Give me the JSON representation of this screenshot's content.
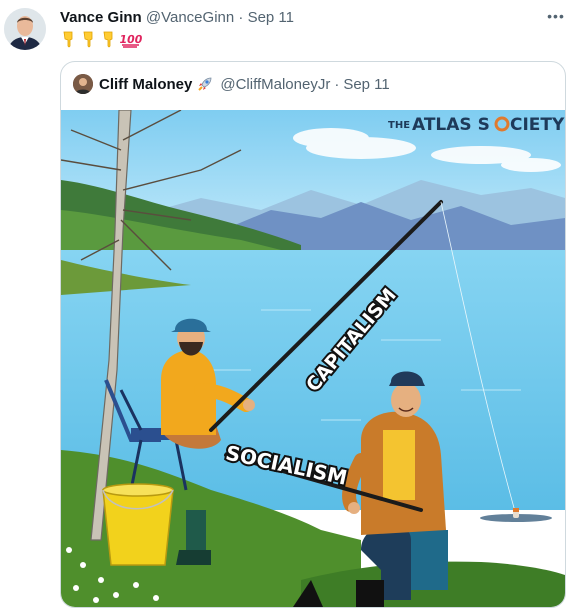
{
  "tweet": {
    "author_name": "Vance Ginn",
    "author_handle": "@VanceGinn",
    "separator": "·",
    "date": "Sep 11",
    "more_label": "•••",
    "emojis": [
      "pointing-down-hand-icon",
      "pointing-down-hand-icon",
      "pointing-down-hand-icon",
      "hundred-points-icon"
    ]
  },
  "quoted_tweet": {
    "author_name": "Cliff Maloney",
    "author_badge": "rocket-icon",
    "author_handle": "@CliffMaloneyJr",
    "separator": "·",
    "date": "Sep 11"
  },
  "meme": {
    "logo_prefix": "THE",
    "logo_main_a": "ATLAS S",
    "logo_main_b": "CIETY",
    "label_rod": "CAPITALISM",
    "label_bag": "SOCIALISM"
  },
  "colors": {
    "sky": "#8fd3f0",
    "lake": "#6fc8ec",
    "grass": "#4f8f2c",
    "shirt_left": "#f2a81d",
    "jacket_right": "#c97b2a",
    "bucket": "#f2d21c"
  }
}
